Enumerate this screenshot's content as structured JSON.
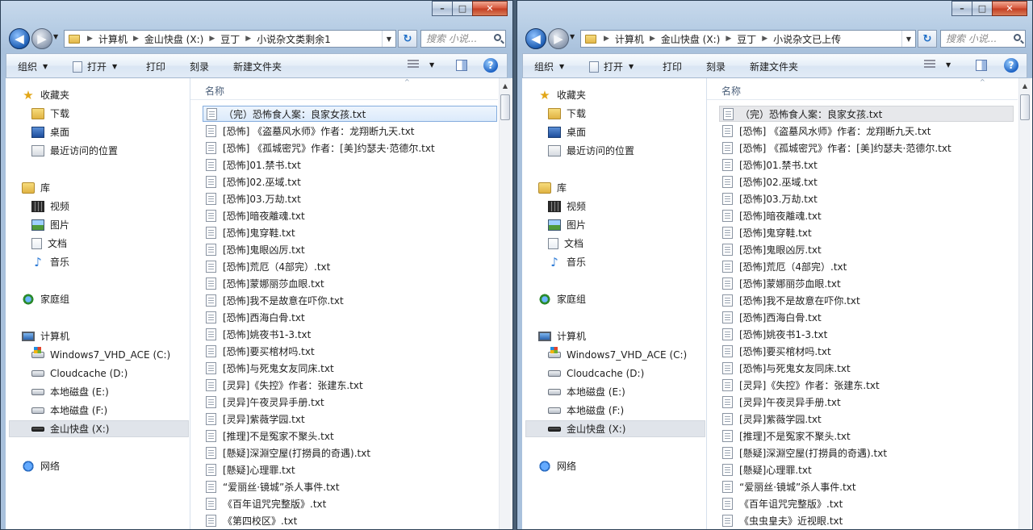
{
  "icons": {
    "back": "back-arrow-icon",
    "forward": "forward-arrow-icon",
    "refresh": "refresh-icon",
    "search": "search-icon",
    "help": "help-icon"
  },
  "caption": {
    "min": "–",
    "max": "□",
    "close": "✕"
  },
  "toolbar": {
    "organize": "组织",
    "open": "打开",
    "print": "打印",
    "burn": "刻录",
    "new_folder": "新建文件夹"
  },
  "column_header": "名称",
  "search_placeholder": "搜索 小说...",
  "nav": {
    "favorites": "收藏夹",
    "downloads": "下载",
    "desktop": "桌面",
    "recent": "最近访问的位置",
    "libraries": "库",
    "videos": "视频",
    "pictures": "图片",
    "documents": "文档",
    "music": "音乐",
    "homegroup": "家庭组",
    "computer": "计算机",
    "drive_c": "Windows7_VHD_ACE (C:)",
    "drive_d": "Cloudcache (D:)",
    "drive_e": "本地磁盘 (E:)",
    "drive_f": "本地磁盘 (F:)",
    "drive_x": "金山快盘 (X:)",
    "network": "网络"
  },
  "left": {
    "breadcrumb": [
      "计算机",
      "金山快盘 (X:)",
      "豆丁",
      "小说杂文类剩余1"
    ],
    "files": [
      "（完）恐怖食人案：良家女孩.txt",
      "[恐怖] 《盗墓风水师》作者：龙翔断九天.txt",
      "[恐怖] 《孤城密咒》作者：[美]约瑟夫·范德尔.txt",
      "[恐怖]01.禁书.txt",
      "[恐怖]02.巫域.txt",
      "[恐怖]03.万劫.txt",
      "[恐怖]暗夜離魂.txt",
      "[恐怖]鬼穿鞋.txt",
      "[恐怖]鬼眼凶厉.txt",
      "[恐怖]荒厄（4部完）.txt",
      "[恐怖]蒙娜丽莎血眼.txt",
      "[恐怖]我不是故意在吓你.txt",
      "[恐怖]西海白骨.txt",
      "[恐怖]姚夜书1-3.txt",
      "[恐怖]要买棺材吗.txt",
      "[恐怖]与死鬼女友同床.txt",
      "[灵异]《失控》作者：张建东.txt",
      "[灵异]午夜灵异手册.txt",
      "[灵异]紫薇学园.txt",
      "[推理]不是冤家不聚头.txt",
      "[懸疑]深淵空屋(打撈員的奇遇).txt",
      "[懸疑]心理罪.txt",
      "“爱丽丝·镜城”杀人事件.txt",
      "《百年诅咒完整版》.txt",
      "《第四校区》.txt"
    ]
  },
  "right": {
    "breadcrumb": [
      "计算机",
      "金山快盘 (X:)",
      "豆丁",
      "小说杂文已上传"
    ],
    "files": [
      "（完）恐怖食人案：良家女孩.txt",
      "[恐怖] 《盗墓风水师》作者：龙翔断九天.txt",
      "[恐怖] 《孤城密咒》作者：[美]约瑟夫·范德尔.txt",
      "[恐怖]01.禁书.txt",
      "[恐怖]02.巫域.txt",
      "[恐怖]03.万劫.txt",
      "[恐怖]暗夜離魂.txt",
      "[恐怖]鬼穿鞋.txt",
      "[恐怖]鬼眼凶厉.txt",
      "[恐怖]荒厄（4部完）.txt",
      "[恐怖]蒙娜丽莎血眼.txt",
      "[恐怖]我不是故意在吓你.txt",
      "[恐怖]西海白骨.txt",
      "[恐怖]姚夜书1-3.txt",
      "[恐怖]要买棺材吗.txt",
      "[恐怖]与死鬼女友同床.txt",
      "[灵异]《失控》作者：张建东.txt",
      "[灵异]午夜灵异手册.txt",
      "[灵异]紫薇学园.txt",
      "[推理]不是冤家不聚头.txt",
      "[懸疑]深淵空屋(打撈員的奇遇).txt",
      "[懸疑]心理罪.txt",
      "“爱丽丝·镜城”杀人事件.txt",
      "《百年诅咒完整版》.txt",
      "《虫虫皇夫》近视眼.txt"
    ]
  }
}
